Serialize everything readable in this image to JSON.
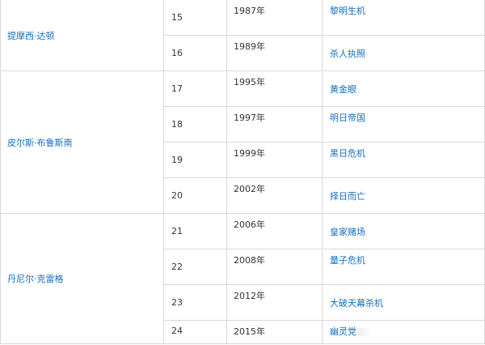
{
  "rows": [
    {
      "actor": "提摩西·达顿",
      "num": "15",
      "year": "1987年",
      "film": "黎明生机"
    },
    {
      "num": "16",
      "year": "1989年",
      "film": "杀人执照"
    },
    {
      "actor": "皮尔斯·布鲁斯南",
      "num": "17",
      "year": "1995年",
      "film": "黄金眼"
    },
    {
      "num": "18",
      "year": "1997年",
      "film": "明日帝国"
    },
    {
      "num": "19",
      "year": "1999年",
      "film": "黑日危机"
    },
    {
      "num": "20",
      "year": "2002年",
      "film": "择日而亡"
    },
    {
      "actor": "丹尼尔·克雷格",
      "num": "21",
      "year": "2006年",
      "film": "皇家赌场"
    },
    {
      "num": "22",
      "year": "2008年",
      "film": "量子危机"
    },
    {
      "num": "23",
      "year": "2012年",
      "film": "大破天幕杀机"
    },
    {
      "num": "24",
      "year": "2015年",
      "film": "幽灵党"
    }
  ],
  "colors": {
    "link": "#136ec2",
    "border": "#d8d8d8",
    "text": "#333333"
  }
}
